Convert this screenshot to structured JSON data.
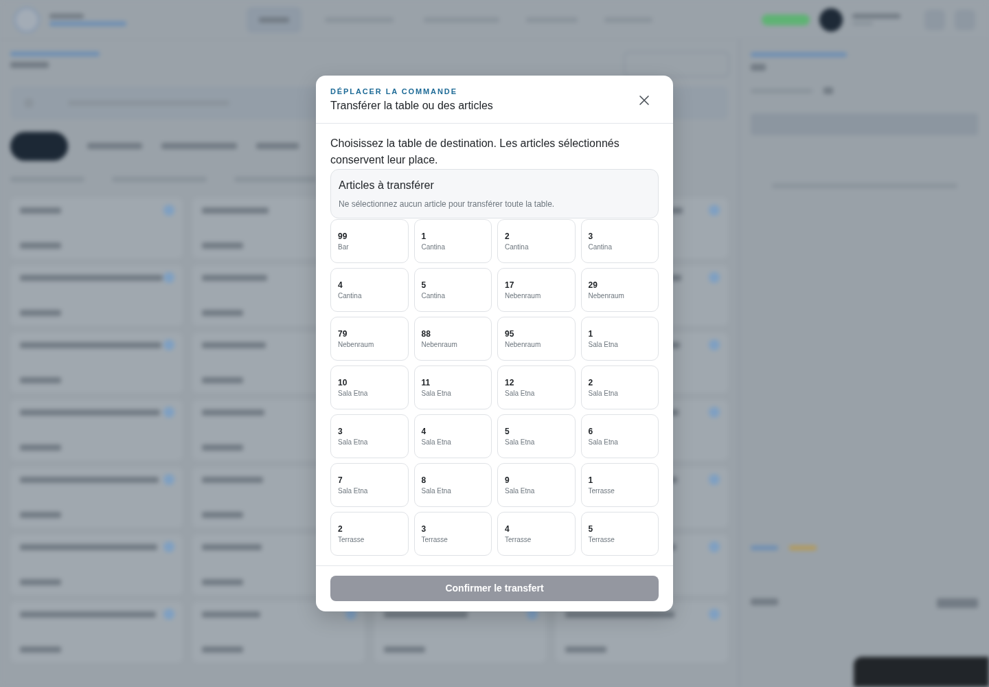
{
  "dialog": {
    "eyebrow": "DÉPLACER LA COMMANDE",
    "title": "Transférer la table ou des articles",
    "instructions": "Choisissez la table de destination. Les articles sélectionnés conservent leur place.",
    "items_box": {
      "title": "Articles à transférer",
      "hint": "Ne sélectionnez aucun article pour transférer toute la table."
    },
    "tables": [
      {
        "number": "99",
        "area": "Bar",
        "selected": false
      },
      {
        "number": "1",
        "area": "Cantina",
        "selected": false
      },
      {
        "number": "2",
        "area": "Cantina",
        "selected": false
      },
      {
        "number": "3",
        "area": "Cantina",
        "selected": false
      },
      {
        "number": "4",
        "area": "Cantina",
        "selected": false
      },
      {
        "number": "5",
        "area": "Cantina",
        "selected": false
      },
      {
        "number": "17",
        "area": "Nebenraum",
        "selected": false
      },
      {
        "number": "29",
        "area": "Nebenraum",
        "selected": false
      },
      {
        "number": "79",
        "area": "Nebenraum",
        "selected": false
      },
      {
        "number": "88",
        "area": "Nebenraum",
        "selected": false
      },
      {
        "number": "95",
        "area": "Nebenraum",
        "selected": false
      },
      {
        "number": "1",
        "area": "Sala Etna",
        "selected": false
      },
      {
        "number": "10",
        "area": "Sala Etna",
        "selected": false
      },
      {
        "number": "11",
        "area": "Sala Etna",
        "selected": false
      },
      {
        "number": "12",
        "area": "Sala Etna",
        "selected": false
      },
      {
        "number": "2",
        "area": "Sala Etna",
        "selected": false
      },
      {
        "number": "3",
        "area": "Sala Etna",
        "selected": false
      },
      {
        "number": "4",
        "area": "Sala Etna",
        "selected": false
      },
      {
        "number": "5",
        "area": "Sala Etna",
        "selected": false
      },
      {
        "number": "6",
        "area": "Sala Etna",
        "selected": false
      },
      {
        "number": "7",
        "area": "Sala Etna",
        "selected": false
      },
      {
        "number": "8",
        "area": "Sala Etna",
        "selected": false
      },
      {
        "number": "9",
        "area": "Sala Etna",
        "selected": false
      },
      {
        "number": "1",
        "area": "Terrasse",
        "selected": false
      },
      {
        "number": "2",
        "area": "Terrasse",
        "selected": false
      },
      {
        "number": "3",
        "area": "Terrasse",
        "selected": false
      },
      {
        "number": "4",
        "area": "Terrasse",
        "selected": false
      },
      {
        "number": "5",
        "area": "Terrasse",
        "selected": false
      }
    ],
    "confirm_button": {
      "label": "Confirmer le transfert",
      "disabled": true
    }
  }
}
